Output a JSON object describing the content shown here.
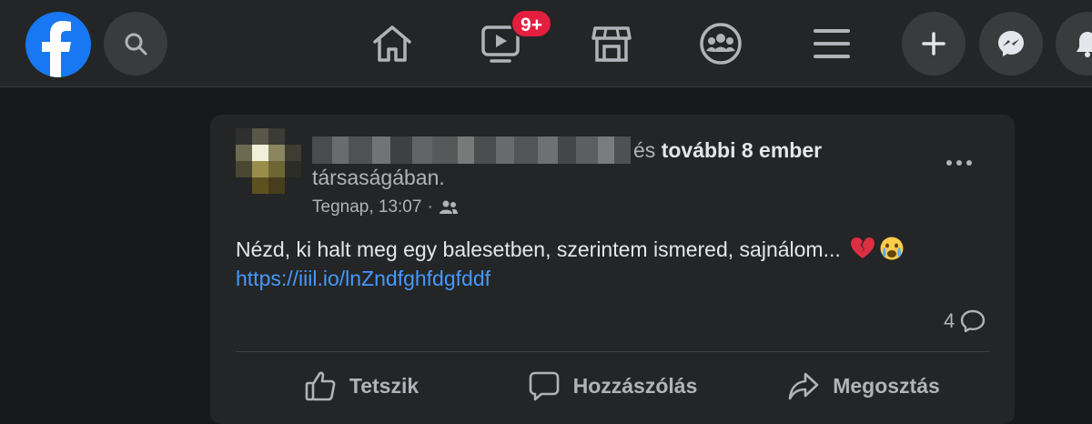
{
  "topbar": {
    "logo_icon": "facebook-logo",
    "search_icon": "search-icon",
    "nav": [
      {
        "name": "home",
        "icon": "home-icon"
      },
      {
        "name": "watch",
        "icon": "video-icon",
        "badge": "9+"
      },
      {
        "name": "marketplace",
        "icon": "marketplace-icon"
      },
      {
        "name": "groups",
        "icon": "groups-icon"
      },
      {
        "name": "menu",
        "icon": "hamburger-icon"
      }
    ],
    "right_buttons": [
      {
        "name": "create",
        "icon": "plus-icon"
      },
      {
        "name": "messenger",
        "icon": "messenger-icon"
      },
      {
        "name": "notifications",
        "icon": "bell-icon"
      }
    ],
    "accent_color": "#1877f2",
    "badge_color": "#e41e3f"
  },
  "post": {
    "author_line": {
      "connector": "és",
      "others": "további 8 ember",
      "continuation": "társaságában."
    },
    "timestamp": "Tegnap, 13:07",
    "separator": "·",
    "audience_icon": "friends-icon",
    "body": "Nézd, ki halt meg egy balesetben, szerintem ismered, sajnálom...",
    "emojis": [
      "broken-heart-icon",
      "crying-face-icon"
    ],
    "link": "https://iiil.io/lnZndfghfdgfddf",
    "link_color": "#4599ff",
    "comment_count": "4",
    "actions": [
      {
        "label": "Tetszik",
        "icon": "like-icon"
      },
      {
        "label": "Hozzászólás",
        "icon": "comment-icon"
      },
      {
        "label": "Megosztás",
        "icon": "share-icon"
      }
    ]
  }
}
